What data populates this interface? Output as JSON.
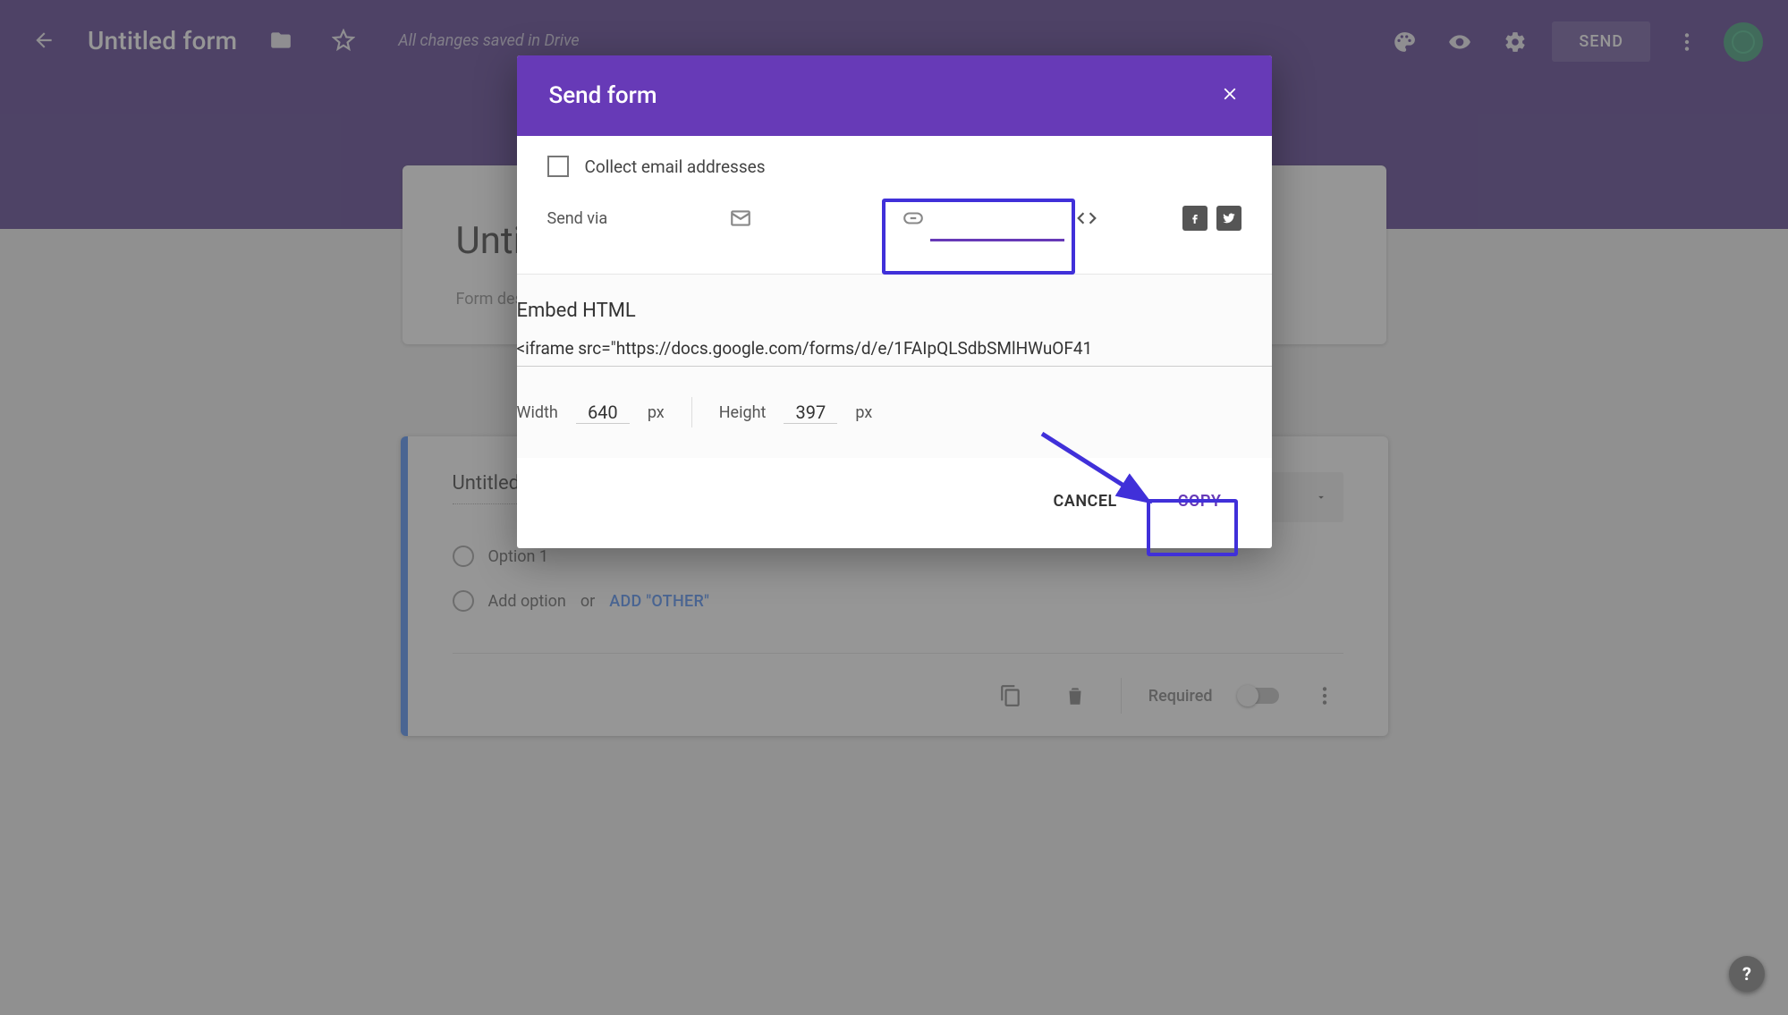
{
  "header": {
    "title": "Untitled form",
    "save_status": "All changes saved in Drive",
    "send_label": "SEND"
  },
  "form_bg": {
    "title": "Untitled form",
    "description_placeholder": "Form description"
  },
  "question": {
    "title": "Untitled Question",
    "option1": "Option 1",
    "add_option": "Add option",
    "or": "or",
    "add_other": "ADD \"OTHER\"",
    "required": "Required"
  },
  "dialog": {
    "title": "Send form",
    "collect": "Collect email addresses",
    "send_via": "Send via",
    "embed": {
      "title": "Embed HTML",
      "value": "<iframe src=\"https://docs.google.com/forms/d/e/1FAIpQLSdbSMlHWuOF41",
      "width_label": "Width",
      "width_value": "640",
      "height_label": "Height",
      "height_value": "397",
      "px": "px"
    },
    "cancel": "CANCEL",
    "copy": "COPY"
  },
  "help": "?"
}
